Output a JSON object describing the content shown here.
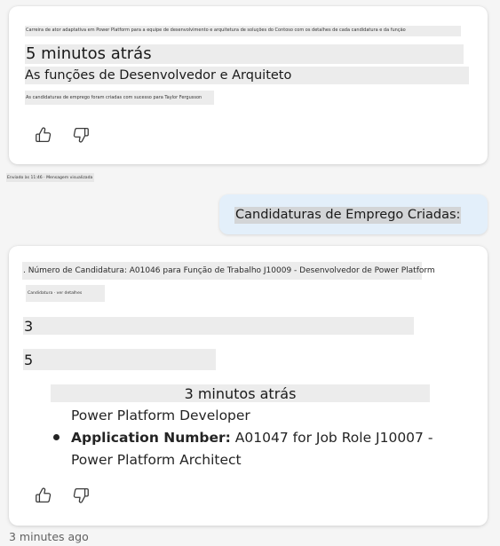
{
  "card1": {
    "tiny_line": "Carreira de ator adaptativa em Power Platform para a equipe de desenvolvimento e arquitetura de soluções do Contoso com os detalhes de cada candidatura e da função",
    "timestamp": "5 minutos atrás",
    "heading": "As funções de Desenvolvedor e Arquiteto",
    "subtext": "As candidaturas de emprego foram criadas com sucesso para Taylor Fergusson"
  },
  "timestamp_small": "Enviado às 11:46 · Mensagem visualizada",
  "user_message": "Candidaturas de Emprego Criadas:",
  "card2": {
    "line1": ". Número de Candidatura: A01046 para Função de Trabalho J10009 - Desenvolvedor de Power Platform",
    "tiny_sub": "Candidatura · ver detalhes",
    "item_three": "3",
    "item_five": "5",
    "timestamp": "3 minutos atrás",
    "continuation": "Power Platform Developer",
    "app_label": "Application Number:",
    "app_value": " A01047 for Job Role J10007 -",
    "app_value_cont": "Power Platform Architect"
  },
  "bottom_timestamp": "3 minutes ago",
  "icons": {
    "like": "thumbs-up-icon",
    "dislike": "thumbs-down-icon"
  },
  "colors": {
    "page_bg": "#f5f5f5",
    "card_bg": "#ffffff",
    "user_bubble_bg": "#e3effa",
    "secondary_text": "#616161"
  }
}
